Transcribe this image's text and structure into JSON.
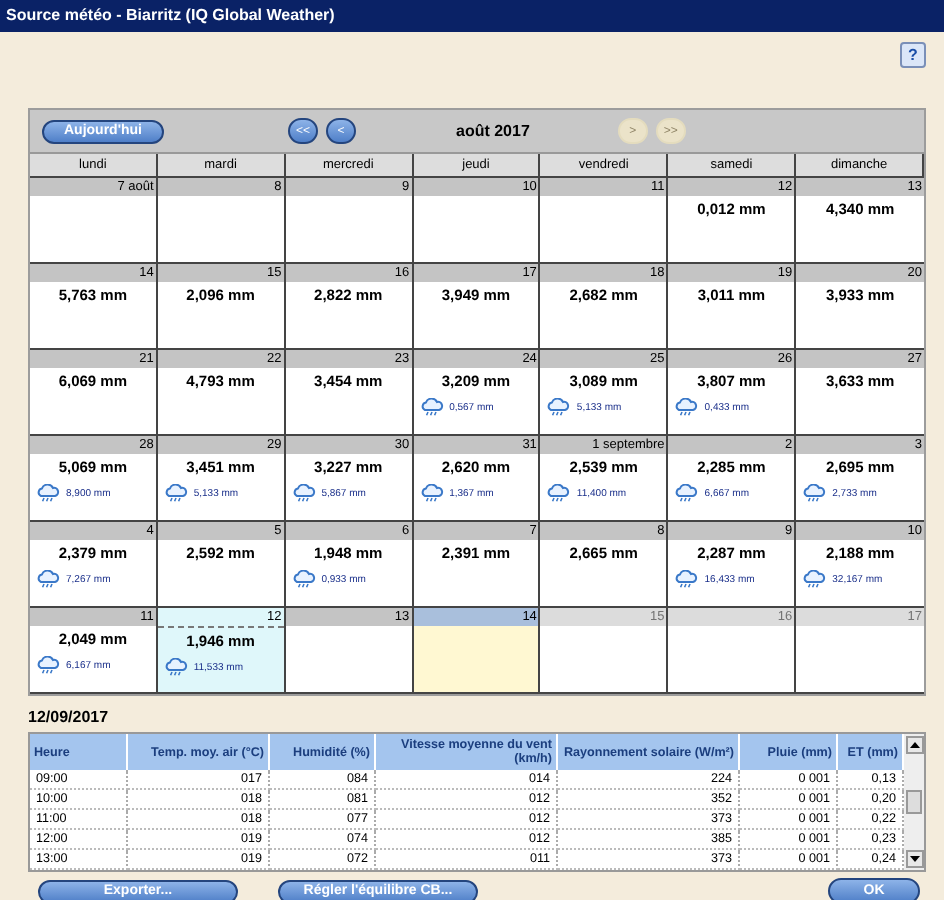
{
  "window": {
    "title": "Source météo - Biarritz (IQ Global Weather)"
  },
  "help_button": {
    "label": "?"
  },
  "calendar": {
    "today_button": "Aujourd'hui",
    "nav_buttons": [
      {
        "label": "<<",
        "disabled": false
      },
      {
        "label": "<",
        "disabled": false
      }
    ],
    "month": "août 2017",
    "nav_buttons_next": [
      {
        "label": ">",
        "disabled": true
      },
      {
        "label": ">>",
        "disabled": true
      }
    ],
    "weekdays": [
      "lundi",
      "mardi",
      "mercredi",
      "jeudi",
      "vendredi",
      "samedi",
      "dimanche"
    ],
    "weeks": [
      [
        {
          "date": "7 août",
          "kind": "day",
          "selected": false
        },
        {
          "date": "8",
          "kind": "day",
          "selected": false
        },
        {
          "date": "9",
          "kind": "day",
          "selected": false
        },
        {
          "date": "10",
          "kind": "day",
          "selected": false
        },
        {
          "date": "11",
          "kind": "day",
          "selected": false
        },
        {
          "date": "12",
          "kind": "day",
          "selected": false,
          "et": "0,012 mm"
        },
        {
          "date": "13",
          "kind": "day",
          "selected": false,
          "et": "4,340 mm"
        }
      ],
      [
        {
          "date": "14",
          "kind": "day",
          "selected": false,
          "et": "5,763 mm"
        },
        {
          "date": "15",
          "kind": "day",
          "selected": false,
          "et": "2,096 mm"
        },
        {
          "date": "16",
          "kind": "day",
          "selected": false,
          "et": "2,822 mm"
        },
        {
          "date": "17",
          "kind": "day",
          "selected": false,
          "et": "3,949 mm"
        },
        {
          "date": "18",
          "kind": "day",
          "selected": false,
          "et": "2,682 mm"
        },
        {
          "date": "19",
          "kind": "day",
          "selected": false,
          "et": "3,011 mm"
        },
        {
          "date": "20",
          "kind": "day",
          "selected": false,
          "et": "3,933 mm"
        }
      ],
      [
        {
          "date": "21",
          "kind": "day",
          "selected": false,
          "et": "6,069 mm"
        },
        {
          "date": "22",
          "kind": "day",
          "selected": false,
          "et": "4,793 mm"
        },
        {
          "date": "23",
          "kind": "day",
          "selected": false,
          "et": "3,454 mm"
        },
        {
          "date": "24",
          "kind": "day",
          "selected": false,
          "et": "3,209 mm",
          "rain": "0,567 mm"
        },
        {
          "date": "25",
          "kind": "day",
          "selected": false,
          "et": "3,089 mm",
          "rain": "5,133 mm"
        },
        {
          "date": "26",
          "kind": "day",
          "selected": false,
          "et": "3,807 mm",
          "rain": "0,433 mm"
        },
        {
          "date": "27",
          "kind": "day",
          "selected": false,
          "et": "3,633 mm"
        }
      ],
      [
        {
          "date": "28",
          "kind": "day",
          "selected": false,
          "et": "5,069 mm",
          "rain": "8,900 mm"
        },
        {
          "date": "29",
          "kind": "day",
          "selected": false,
          "et": "3,451 mm",
          "rain": "5,133 mm"
        },
        {
          "date": "30",
          "kind": "day",
          "selected": false,
          "et": "3,227 mm",
          "rain": "5,867 mm"
        },
        {
          "date": "31",
          "kind": "day",
          "selected": false,
          "et": "2,620 mm",
          "rain": "1,367 mm"
        },
        {
          "date": "1 septembre",
          "kind": "day",
          "selected": false,
          "et": "2,539 mm",
          "rain": "11,400 mm"
        },
        {
          "date": "2",
          "kind": "day",
          "selected": false,
          "et": "2,285 mm",
          "rain": "6,667 mm"
        },
        {
          "date": "3",
          "kind": "day",
          "selected": false,
          "et": "2,695 mm",
          "rain": "2,733 mm"
        }
      ],
      [
        {
          "date": "4",
          "kind": "day",
          "selected": false,
          "et": "2,379 mm",
          "rain": "7,267 mm"
        },
        {
          "date": "5",
          "kind": "day",
          "selected": false,
          "et": "2,592 mm"
        },
        {
          "date": "6",
          "kind": "day",
          "selected": false,
          "et": "1,948 mm",
          "rain": "0,933 mm"
        },
        {
          "date": "7",
          "kind": "day",
          "selected": false,
          "et": "2,391 mm"
        },
        {
          "date": "8",
          "kind": "day",
          "selected": false,
          "et": "2,665 mm"
        },
        {
          "date": "9",
          "kind": "day",
          "selected": false,
          "et": "2,287 mm",
          "rain": "16,433 mm"
        },
        {
          "date": "10",
          "kind": "day",
          "selected": false,
          "et": "2,188 mm",
          "rain": "32,167 mm"
        }
      ],
      [
        {
          "date": "11",
          "kind": "day",
          "selected": false,
          "et": "2,049 mm",
          "rain": "6,167 mm"
        },
        {
          "date": "12",
          "kind": "day",
          "selected": true,
          "et": "1,946 mm",
          "rain": "11,533 mm"
        },
        {
          "date": "13",
          "kind": "day",
          "selected": false
        },
        {
          "date": "14",
          "kind": "today",
          "selected": false
        },
        {
          "date": "15",
          "kind": "future",
          "selected": false
        },
        {
          "date": "16",
          "kind": "future",
          "selected": false
        },
        {
          "date": "17",
          "kind": "future",
          "selected": false
        }
      ]
    ]
  },
  "detail": {
    "date": "12/09/2017",
    "columns": [
      "Heure",
      "Temp. moy. air (°C)",
      "Humidité (%)",
      "Vitesse moyenne du vent (km/h)",
      "Rayonnement solaire (W/m²)",
      "Pluie (mm)",
      "ET (mm)"
    ],
    "rows": [
      [
        "09:00",
        "017",
        "084",
        "014",
        "224",
        "0 001",
        "0,13"
      ],
      [
        "10:00",
        "018",
        "081",
        "012",
        "352",
        "0 001",
        "0,20"
      ],
      [
        "11:00",
        "018",
        "077",
        "012",
        "373",
        "0 001",
        "0,22"
      ],
      [
        "12:00",
        "019",
        "074",
        "012",
        "385",
        "0 001",
        "0,23"
      ],
      [
        "13:00",
        "019",
        "072",
        "011",
        "373",
        "0 001",
        "0,24"
      ]
    ]
  },
  "buttons": [
    {
      "label": "Exporter..."
    },
    {
      "label": "Régler l'équilibre CB..."
    }
  ],
  "ok_button": "OK"
}
